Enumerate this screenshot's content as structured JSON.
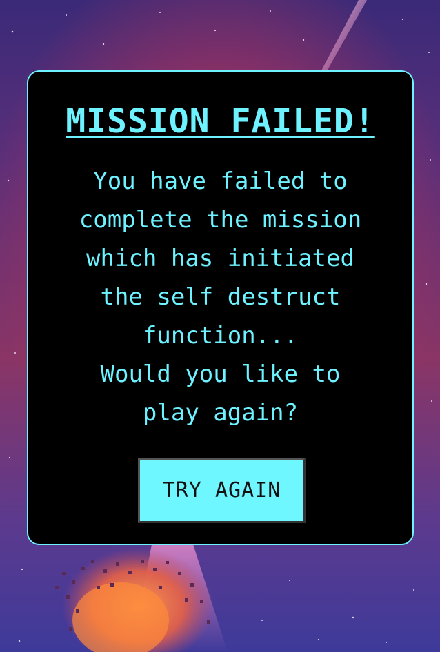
{
  "dialog": {
    "title": "MISSION FAILED!",
    "message_lines": [
      "You have failed to",
      "complete the mission",
      "which has initiated",
      "the self destruct",
      "function...",
      "Would you like to",
      "play again?"
    ],
    "button_label": "TRY AGAIN"
  },
  "colors": {
    "accent": "#6ef2ff",
    "panel_bg": "#000000",
    "button_bg": "#6ef7ff",
    "button_text": "#111111"
  },
  "icons": [
    "starfield-background",
    "comet-streak",
    "explosion-debris"
  ]
}
